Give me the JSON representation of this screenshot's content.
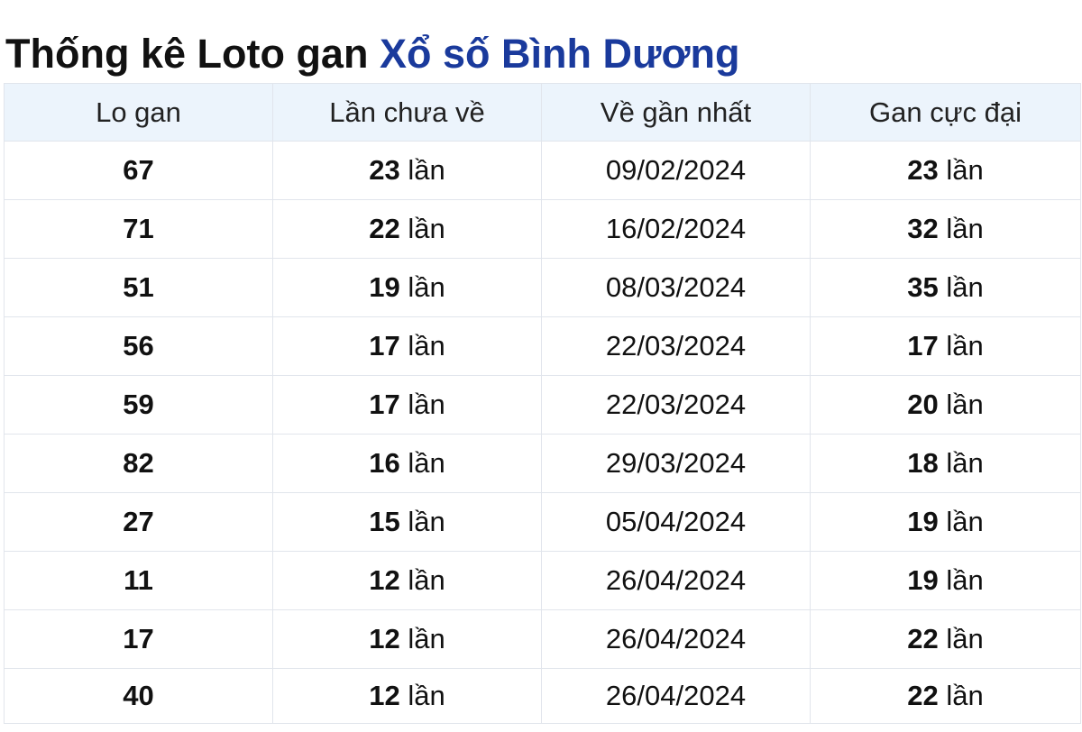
{
  "title": {
    "prefix": "Thống kê Loto gan ",
    "link": "Xổ số Bình Dương"
  },
  "table": {
    "headers": [
      "Lo gan",
      "Lần chưa về",
      "Về gần nhất",
      "Gan cực đại"
    ],
    "unit": "lần",
    "rows": [
      {
        "lo": "67",
        "chua_ve": "23",
        "gan_nhat": "09/02/2024",
        "cuc_dai": "23"
      },
      {
        "lo": "71",
        "chua_ve": "22",
        "gan_nhat": "16/02/2024",
        "cuc_dai": "32"
      },
      {
        "lo": "51",
        "chua_ve": "19",
        "gan_nhat": "08/03/2024",
        "cuc_dai": "35"
      },
      {
        "lo": "56",
        "chua_ve": "17",
        "gan_nhat": "22/03/2024",
        "cuc_dai": "17"
      },
      {
        "lo": "59",
        "chua_ve": "17",
        "gan_nhat": "22/03/2024",
        "cuc_dai": "20"
      },
      {
        "lo": "82",
        "chua_ve": "16",
        "gan_nhat": "29/03/2024",
        "cuc_dai": "18"
      },
      {
        "lo": "27",
        "chua_ve": "15",
        "gan_nhat": "05/04/2024",
        "cuc_dai": "19"
      },
      {
        "lo": "11",
        "chua_ve": "12",
        "gan_nhat": "26/04/2024",
        "cuc_dai": "19"
      },
      {
        "lo": "17",
        "chua_ve": "12",
        "gan_nhat": "26/04/2024",
        "cuc_dai": "22"
      },
      {
        "lo": "40",
        "chua_ve": "12",
        "gan_nhat": "26/04/2024",
        "cuc_dai": "22"
      }
    ]
  }
}
